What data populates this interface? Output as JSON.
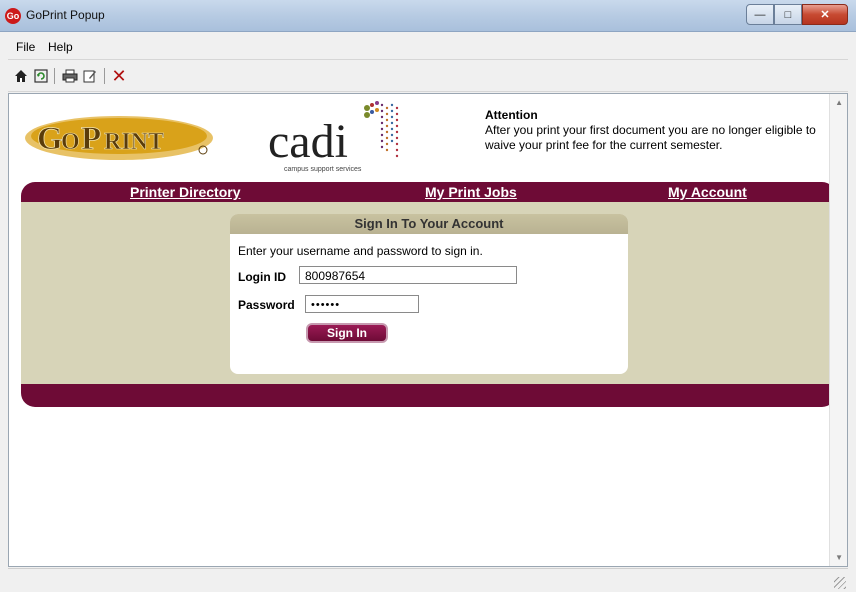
{
  "window": {
    "title": "GoPrint Popup",
    "app_icon": "Go"
  },
  "menu": {
    "items": [
      "File",
      "Help"
    ]
  },
  "toolbar": {
    "icons": [
      "home-icon",
      "refresh-icon",
      "print-icon",
      "edit-icon",
      "close-icon"
    ]
  },
  "branding": {
    "goprint_text": "GoPrint",
    "cadi_text": "cadi",
    "cadi_tagline": "campus support services"
  },
  "attention": {
    "title": "Attention",
    "message": "After you print your first document you are no longer eligible to waive your print fee for the current semester."
  },
  "nav": {
    "printer_directory": "Printer Directory",
    "my_print_jobs": "My Print Jobs",
    "my_account": "My Account"
  },
  "signin": {
    "heading": "Sign In To Your Account",
    "intro": "Enter your username and password to sign in.",
    "login_label": "Login ID",
    "login_value": "800987654",
    "password_label": "Password",
    "password_value": "••••••",
    "button": "Sign In"
  },
  "colors": {
    "nav_maroon": "#6e0b36",
    "panel_beige": "#d7d4b8",
    "goprint_gold": "#d9a21a"
  }
}
